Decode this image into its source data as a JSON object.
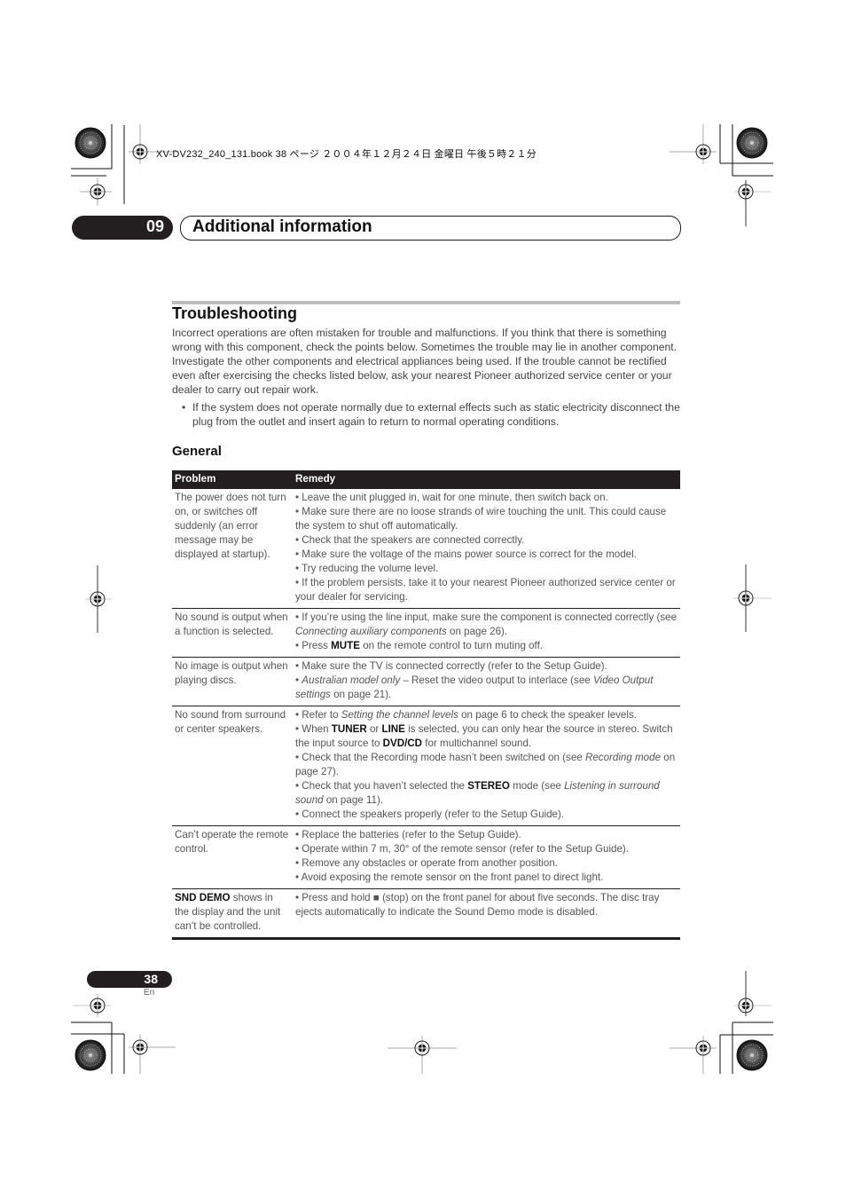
{
  "print_header": "XV-DV232_240_131.book  38 ページ  ２００４年１２月２４日  金曜日  午後５時２１分",
  "chapter": {
    "number": "09",
    "title": "Additional information"
  },
  "section": {
    "title": "Troubleshooting",
    "intro": "Incorrect operations are often mistaken for trouble and malfunctions. If you think that there is something wrong with this component, check the points below. Sometimes the trouble may lie in another component. Investigate the other components and electrical appliances being used. If the trouble cannot be rectified even after exercising the checks listed below, ask your nearest Pioneer authorized service center or your dealer to carry out repair work.",
    "bullet": "If the system does not operate normally due to external effects such as static electricity disconnect the plug from the outlet and insert again to return to normal operating conditions."
  },
  "general": {
    "title": "General",
    "headers": {
      "problem": "Problem",
      "remedy": "Remedy"
    },
    "rows": [
      {
        "problem": "The power does not turn on, or switches off suddenly (an error message may be displayed at startup).",
        "remedies": [
          "• Leave the unit plugged in, wait for one minute, then switch back on.",
          "• Make sure there are no loose strands of wire touching the unit. This could cause the system to shut off automatically.",
          "• Check that the speakers are connected correctly.",
          "• Make sure the voltage of the mains power source is correct for the model.",
          "• Try reducing the volume level.",
          "• If the problem persists, take it to your nearest Pioneer authorized service center or your dealer for servicing."
        ]
      },
      {
        "problem": "No sound is output when a function is selected.",
        "remedies_rich": {
          "r1_a": "• If you’re using the line input, make sure the component is connected correctly (see ",
          "r1_i": "Connecting auxiliary components",
          "r1_b": " on page 26).",
          "r2_a": "• Press ",
          "r2_k": "MUTE",
          "r2_b": " on the remote control to turn muting off."
        }
      },
      {
        "problem": "No image is output when playing discs.",
        "remedies_rich": {
          "r1": "• Make sure the TV is connected correctly (refer to the Setup Guide).",
          "r2_pre": "• ",
          "r2_i": "Australian model only",
          "r2_a": " – Reset the video output to interlace (see ",
          "r2_i2": "Video Output settings",
          "r2_b": " on page 21)."
        }
      },
      {
        "problem": "No sound from surround or center speakers.",
        "remedies_rich": {
          "r1_a": "• Refer to ",
          "r1_i": "Setting the channel levels",
          "r1_b": " on page 6 to check the speaker levels.",
          "r2_a": "• When ",
          "r2_k1": "TUNER",
          "r2_b": " or ",
          "r2_k2": "LINE",
          "r2_c": " is selected, you can only hear the source in stereo. Switch the input source to ",
          "r2_k3": "DVD/CD",
          "r2_d": " for multichannel sound.",
          "r3_a": "• Check that the Recording mode hasn’t been switched on (see ",
          "r3_i": "Recording mode",
          "r3_b": " on page 27).",
          "r4_a": "• Check that you haven’t selected the ",
          "r4_k": "STEREO",
          "r4_b": " mode (see ",
          "r4_i": "Listening in surround sound",
          "r4_c": " on page 11).",
          "r5": "• Connect the speakers properly (refer to the Setup Guide)."
        }
      },
      {
        "problem": "Can’t operate the remote control.",
        "remedies": [
          "• Replace the batteries (refer to the Setup Guide).",
          "• Operate within 7 m, 30° of the remote sensor (refer to the Setup Guide).",
          "• Remove any obstacles or operate from another position.",
          "• Avoid exposing the remote sensor on the front panel to direct light."
        ]
      },
      {
        "problem_k": "SND DEMO",
        "problem": " shows in the display and the unit can’t be controlled.",
        "remedies": [
          "• Press and hold ■ (stop) on the front panel for about five seconds. The disc tray ejects automatically to indicate the Sound Demo mode is disabled."
        ]
      }
    ]
  },
  "footer": {
    "page_number": "38",
    "language": "En"
  }
}
